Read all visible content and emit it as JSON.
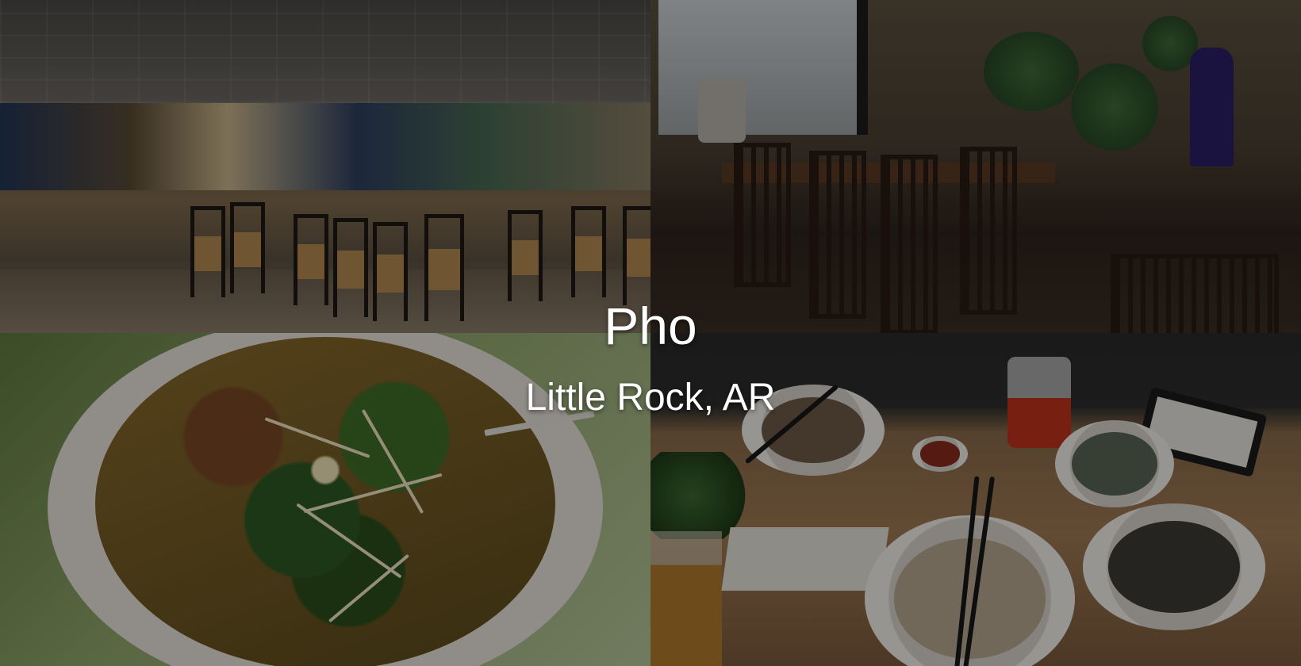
{
  "hero": {
    "title": "Pho",
    "subtitle": "Little Rock, AR"
  },
  "photos": [
    {
      "subject": "restaurant-interior"
    },
    {
      "subject": "dining-room"
    },
    {
      "subject": "pho-bowl-closeup"
    },
    {
      "subject": "table-with-bowls"
    }
  ]
}
